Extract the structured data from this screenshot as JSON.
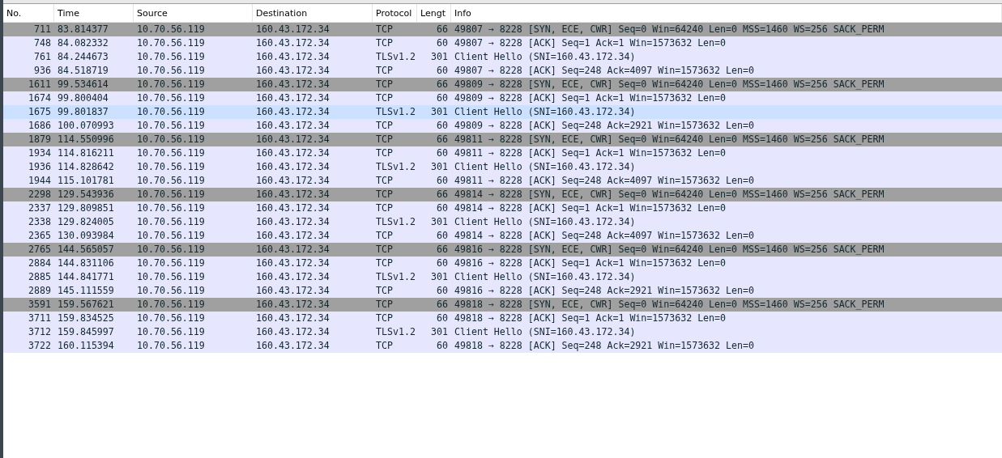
{
  "columns": [
    "No.",
    "Time",
    "Source",
    "Destination",
    "Protocol",
    "Lengt",
    "Info"
  ],
  "rows": [
    {
      "kind": "syn",
      "selected": false,
      "cells": [
        "711",
        "83.814377",
        "10.70.56.119",
        "160.43.172.34",
        "TCP",
        "66",
        "49807 → 8228 [SYN, ECE, CWR] Seq=0 Win=64240 Len=0 MSS=1460 WS=256 SACK_PERM"
      ]
    },
    {
      "kind": "data",
      "selected": false,
      "cells": [
        "748",
        "84.082332",
        "10.70.56.119",
        "160.43.172.34",
        "TCP",
        "60",
        "49807 → 8228 [ACK] Seq=1 Ack=1 Win=1573632 Len=0"
      ]
    },
    {
      "kind": "data",
      "selected": false,
      "cells": [
        "761",
        "84.244673",
        "10.70.56.119",
        "160.43.172.34",
        "TLSv1.2",
        "301",
        "Client Hello (SNI=160.43.172.34)"
      ]
    },
    {
      "kind": "data",
      "selected": false,
      "cells": [
        "936",
        "84.518719",
        "10.70.56.119",
        "160.43.172.34",
        "TCP",
        "60",
        "49807 → 8228 [ACK] Seq=248 Ack=4097 Win=1573632 Len=0"
      ]
    },
    {
      "kind": "syn",
      "selected": false,
      "cells": [
        "1611",
        "99.534614",
        "10.70.56.119",
        "160.43.172.34",
        "TCP",
        "66",
        "49809 → 8228 [SYN, ECE, CWR] Seq=0 Win=64240 Len=0 MSS=1460 WS=256 SACK_PERM"
      ]
    },
    {
      "kind": "data",
      "selected": false,
      "cells": [
        "1674",
        "99.800404",
        "10.70.56.119",
        "160.43.172.34",
        "TCP",
        "60",
        "49809 → 8228 [ACK] Seq=1 Ack=1 Win=1573632 Len=0"
      ]
    },
    {
      "kind": "data",
      "selected": true,
      "cells": [
        "1675",
        "99.801837",
        "10.70.56.119",
        "160.43.172.34",
        "TLSv1.2",
        "301",
        "Client Hello (SNI=160.43.172.34)"
      ]
    },
    {
      "kind": "data",
      "selected": false,
      "cells": [
        "1686",
        "100.070993",
        "10.70.56.119",
        "160.43.172.34",
        "TCP",
        "60",
        "49809 → 8228 [ACK] Seq=248 Ack=2921 Win=1573632 Len=0"
      ]
    },
    {
      "kind": "syn",
      "selected": false,
      "cells": [
        "1879",
        "114.550996",
        "10.70.56.119",
        "160.43.172.34",
        "TCP",
        "66",
        "49811 → 8228 [SYN, ECE, CWR] Seq=0 Win=64240 Len=0 MSS=1460 WS=256 SACK_PERM"
      ]
    },
    {
      "kind": "data",
      "selected": false,
      "cells": [
        "1934",
        "114.816211",
        "10.70.56.119",
        "160.43.172.34",
        "TCP",
        "60",
        "49811 → 8228 [ACK] Seq=1 Ack=1 Win=1573632 Len=0"
      ]
    },
    {
      "kind": "data",
      "selected": false,
      "cells": [
        "1936",
        "114.828642",
        "10.70.56.119",
        "160.43.172.34",
        "TLSv1.2",
        "301",
        "Client Hello (SNI=160.43.172.34)"
      ]
    },
    {
      "kind": "data",
      "selected": false,
      "cells": [
        "1944",
        "115.101781",
        "10.70.56.119",
        "160.43.172.34",
        "TCP",
        "60",
        "49811 → 8228 [ACK] Seq=248 Ack=4097 Win=1573632 Len=0"
      ]
    },
    {
      "kind": "syn",
      "selected": false,
      "cells": [
        "2298",
        "129.543936",
        "10.70.56.119",
        "160.43.172.34",
        "TCP",
        "66",
        "49814 → 8228 [SYN, ECE, CWR] Seq=0 Win=64240 Len=0 MSS=1460 WS=256 SACK_PERM"
      ]
    },
    {
      "kind": "data",
      "selected": false,
      "cells": [
        "2337",
        "129.809851",
        "10.70.56.119",
        "160.43.172.34",
        "TCP",
        "60",
        "49814 → 8228 [ACK] Seq=1 Ack=1 Win=1573632 Len=0"
      ]
    },
    {
      "kind": "data",
      "selected": false,
      "cells": [
        "2338",
        "129.824005",
        "10.70.56.119",
        "160.43.172.34",
        "TLSv1.2",
        "301",
        "Client Hello (SNI=160.43.172.34)"
      ]
    },
    {
      "kind": "data",
      "selected": false,
      "cells": [
        "2365",
        "130.093984",
        "10.70.56.119",
        "160.43.172.34",
        "TCP",
        "60",
        "49814 → 8228 [ACK] Seq=248 Ack=4097 Win=1573632 Len=0"
      ]
    },
    {
      "kind": "syn",
      "selected": false,
      "cells": [
        "2765",
        "144.565057",
        "10.70.56.119",
        "160.43.172.34",
        "TCP",
        "66",
        "49816 → 8228 [SYN, ECE, CWR] Seq=0 Win=64240 Len=0 MSS=1460 WS=256 SACK_PERM"
      ]
    },
    {
      "kind": "data",
      "selected": false,
      "cells": [
        "2884",
        "144.831106",
        "10.70.56.119",
        "160.43.172.34",
        "TCP",
        "60",
        "49816 → 8228 [ACK] Seq=1 Ack=1 Win=1573632 Len=0"
      ]
    },
    {
      "kind": "data",
      "selected": false,
      "cells": [
        "2885",
        "144.841771",
        "10.70.56.119",
        "160.43.172.34",
        "TLSv1.2",
        "301",
        "Client Hello (SNI=160.43.172.34)"
      ]
    },
    {
      "kind": "data",
      "selected": false,
      "cells": [
        "2889",
        "145.111559",
        "10.70.56.119",
        "160.43.172.34",
        "TCP",
        "60",
        "49816 → 8228 [ACK] Seq=248 Ack=2921 Win=1573632 Len=0"
      ]
    },
    {
      "kind": "syn",
      "selected": false,
      "cells": [
        "3591",
        "159.567621",
        "10.70.56.119",
        "160.43.172.34",
        "TCP",
        "66",
        "49818 → 8228 [SYN, ECE, CWR] Seq=0 Win=64240 Len=0 MSS=1460 WS=256 SACK_PERM"
      ]
    },
    {
      "kind": "data",
      "selected": false,
      "cells": [
        "3711",
        "159.834525",
        "10.70.56.119",
        "160.43.172.34",
        "TCP",
        "60",
        "49818 → 8228 [ACK] Seq=1 Ack=1 Win=1573632 Len=0"
      ]
    },
    {
      "kind": "data",
      "selected": false,
      "cells": [
        "3712",
        "159.845997",
        "10.70.56.119",
        "160.43.172.34",
        "TLSv1.2",
        "301",
        "Client Hello (SNI=160.43.172.34)"
      ]
    },
    {
      "kind": "data",
      "selected": false,
      "cells": [
        "3722",
        "160.115394",
        "10.70.56.119",
        "160.43.172.34",
        "TCP",
        "60",
        "49818 → 8228 [ACK] Seq=248 Ack=2921 Win=1573632 Len=0"
      ]
    }
  ]
}
